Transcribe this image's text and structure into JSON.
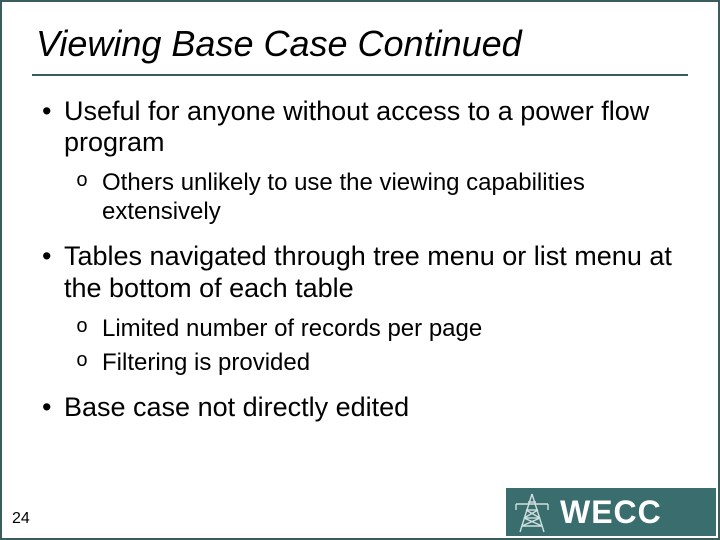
{
  "title": "Viewing Base Case Continued",
  "bullets": [
    {
      "text": "Useful for anyone without access to a power flow program",
      "sub": [
        "Others unlikely to use the viewing capabilities extensively"
      ]
    },
    {
      "text": "Tables navigated through tree menu or list menu at the bottom of each table",
      "sub": [
        "Limited number of records per page",
        "Filtering is provided"
      ]
    },
    {
      "text": "Base case not directly edited",
      "sub": []
    }
  ],
  "page_number": "24",
  "brand": "WECC"
}
